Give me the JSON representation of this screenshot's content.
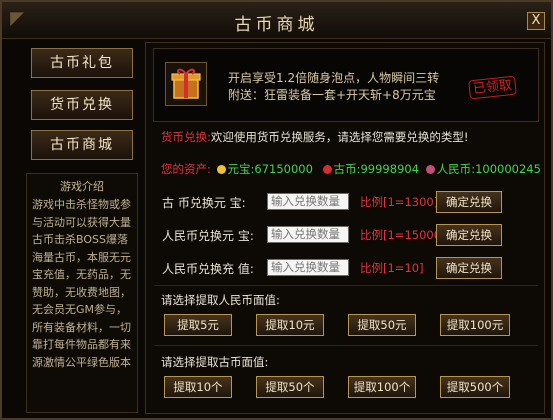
{
  "window": {
    "title": "古币商城",
    "close_label": "X"
  },
  "nav": {
    "items": [
      {
        "label": "古币礼包"
      },
      {
        "label": "货币兑换"
      },
      {
        "label": "古币商城"
      }
    ]
  },
  "intro": {
    "title": "游戏介绍",
    "body": "游戏中击杀怪物或参与活动可以获得大量古币击杀BOSS爆落海量古币，本服无元宝充值，无药品，无赞助，无收费地图，无会员无GM参与，所有装备材料，一切靠打每件物品都有来源激情公平绿色版本"
  },
  "gift": {
    "line1": "开启享受1.2倍随身泡点，人物瞬间三转",
    "line2": "附送：狂雷装备一套+开天斩+8万元宝",
    "claimed_label": "已领取"
  },
  "exchange": {
    "intro_prefix": "货币兑换:",
    "intro_text": "欢迎使用货币兑换服务，请选择您需要兑换的类型!",
    "assets_label": "您的资产:",
    "assets": [
      {
        "name": "元宝",
        "value": "67150000",
        "color": "#f1c232"
      },
      {
        "name": "古币",
        "value": "99998904",
        "color": "#d23030"
      },
      {
        "name": "人民币",
        "value": "100000245",
        "color": "#c0507a"
      }
    ],
    "rows": [
      {
        "label": "古   币兑换元   宝:",
        "placeholder": "输入兑换数量",
        "ratio": "比例[1=1300]",
        "button": "确定兑换"
      },
      {
        "label": "人民币兑换元   宝:",
        "placeholder": "输入兑换数量",
        "ratio": "比例[1=15000]",
        "button": "确定兑换"
      },
      {
        "label": "人民币兑换充   值:",
        "placeholder": "输入兑换数量",
        "ratio": "比例[1=10]",
        "button": "确定兑换"
      }
    ]
  },
  "rmb_withdraw": {
    "prompt": "请选择提取人民币面值:",
    "buttons": [
      "提取5元",
      "提取10元",
      "提取50元",
      "提取100元"
    ]
  },
  "coin_withdraw": {
    "prompt": "请选择提取古币面值:",
    "buttons": [
      "提取10个",
      "提取50个",
      "提取100个",
      "提取500个"
    ]
  },
  "colors": {
    "accent_red": "#e3323d",
    "accent_green": "#3ed84d",
    "gold_border": "#b59455"
  }
}
